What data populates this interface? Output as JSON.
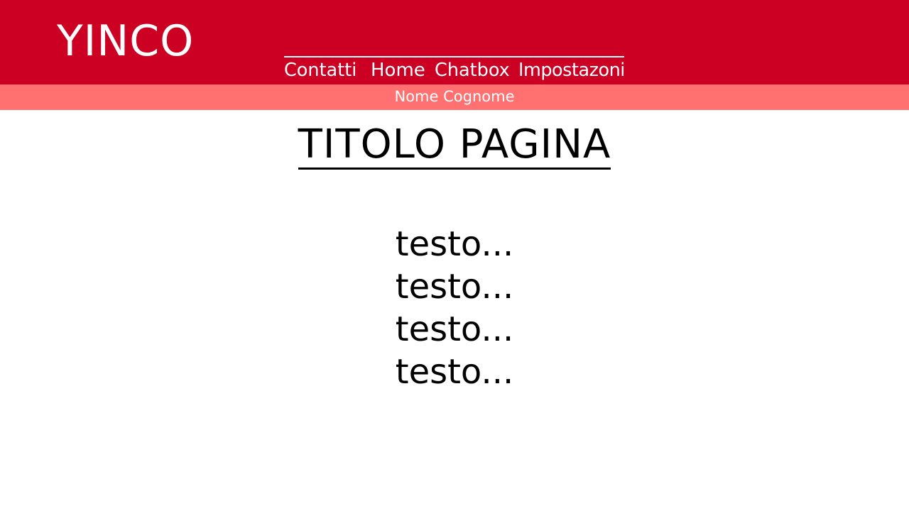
{
  "header": {
    "logo_text": "YINCO",
    "nav": [
      {
        "label": "Contatti"
      },
      {
        "label": "Home"
      },
      {
        "label": "Chatbox"
      },
      {
        "label": "Impostazoni"
      }
    ]
  },
  "user_bar": {
    "name": "Nome Cognome"
  },
  "main": {
    "title": "TITOLO PAGINA",
    "lines": [
      "testo...",
      "testo...",
      "testo...",
      "testo..."
    ]
  },
  "colors": {
    "header_bg": "#cc0022",
    "user_bar_bg": "#ff7070",
    "text_light": "#ffffff",
    "text_dark": "#000000"
  }
}
